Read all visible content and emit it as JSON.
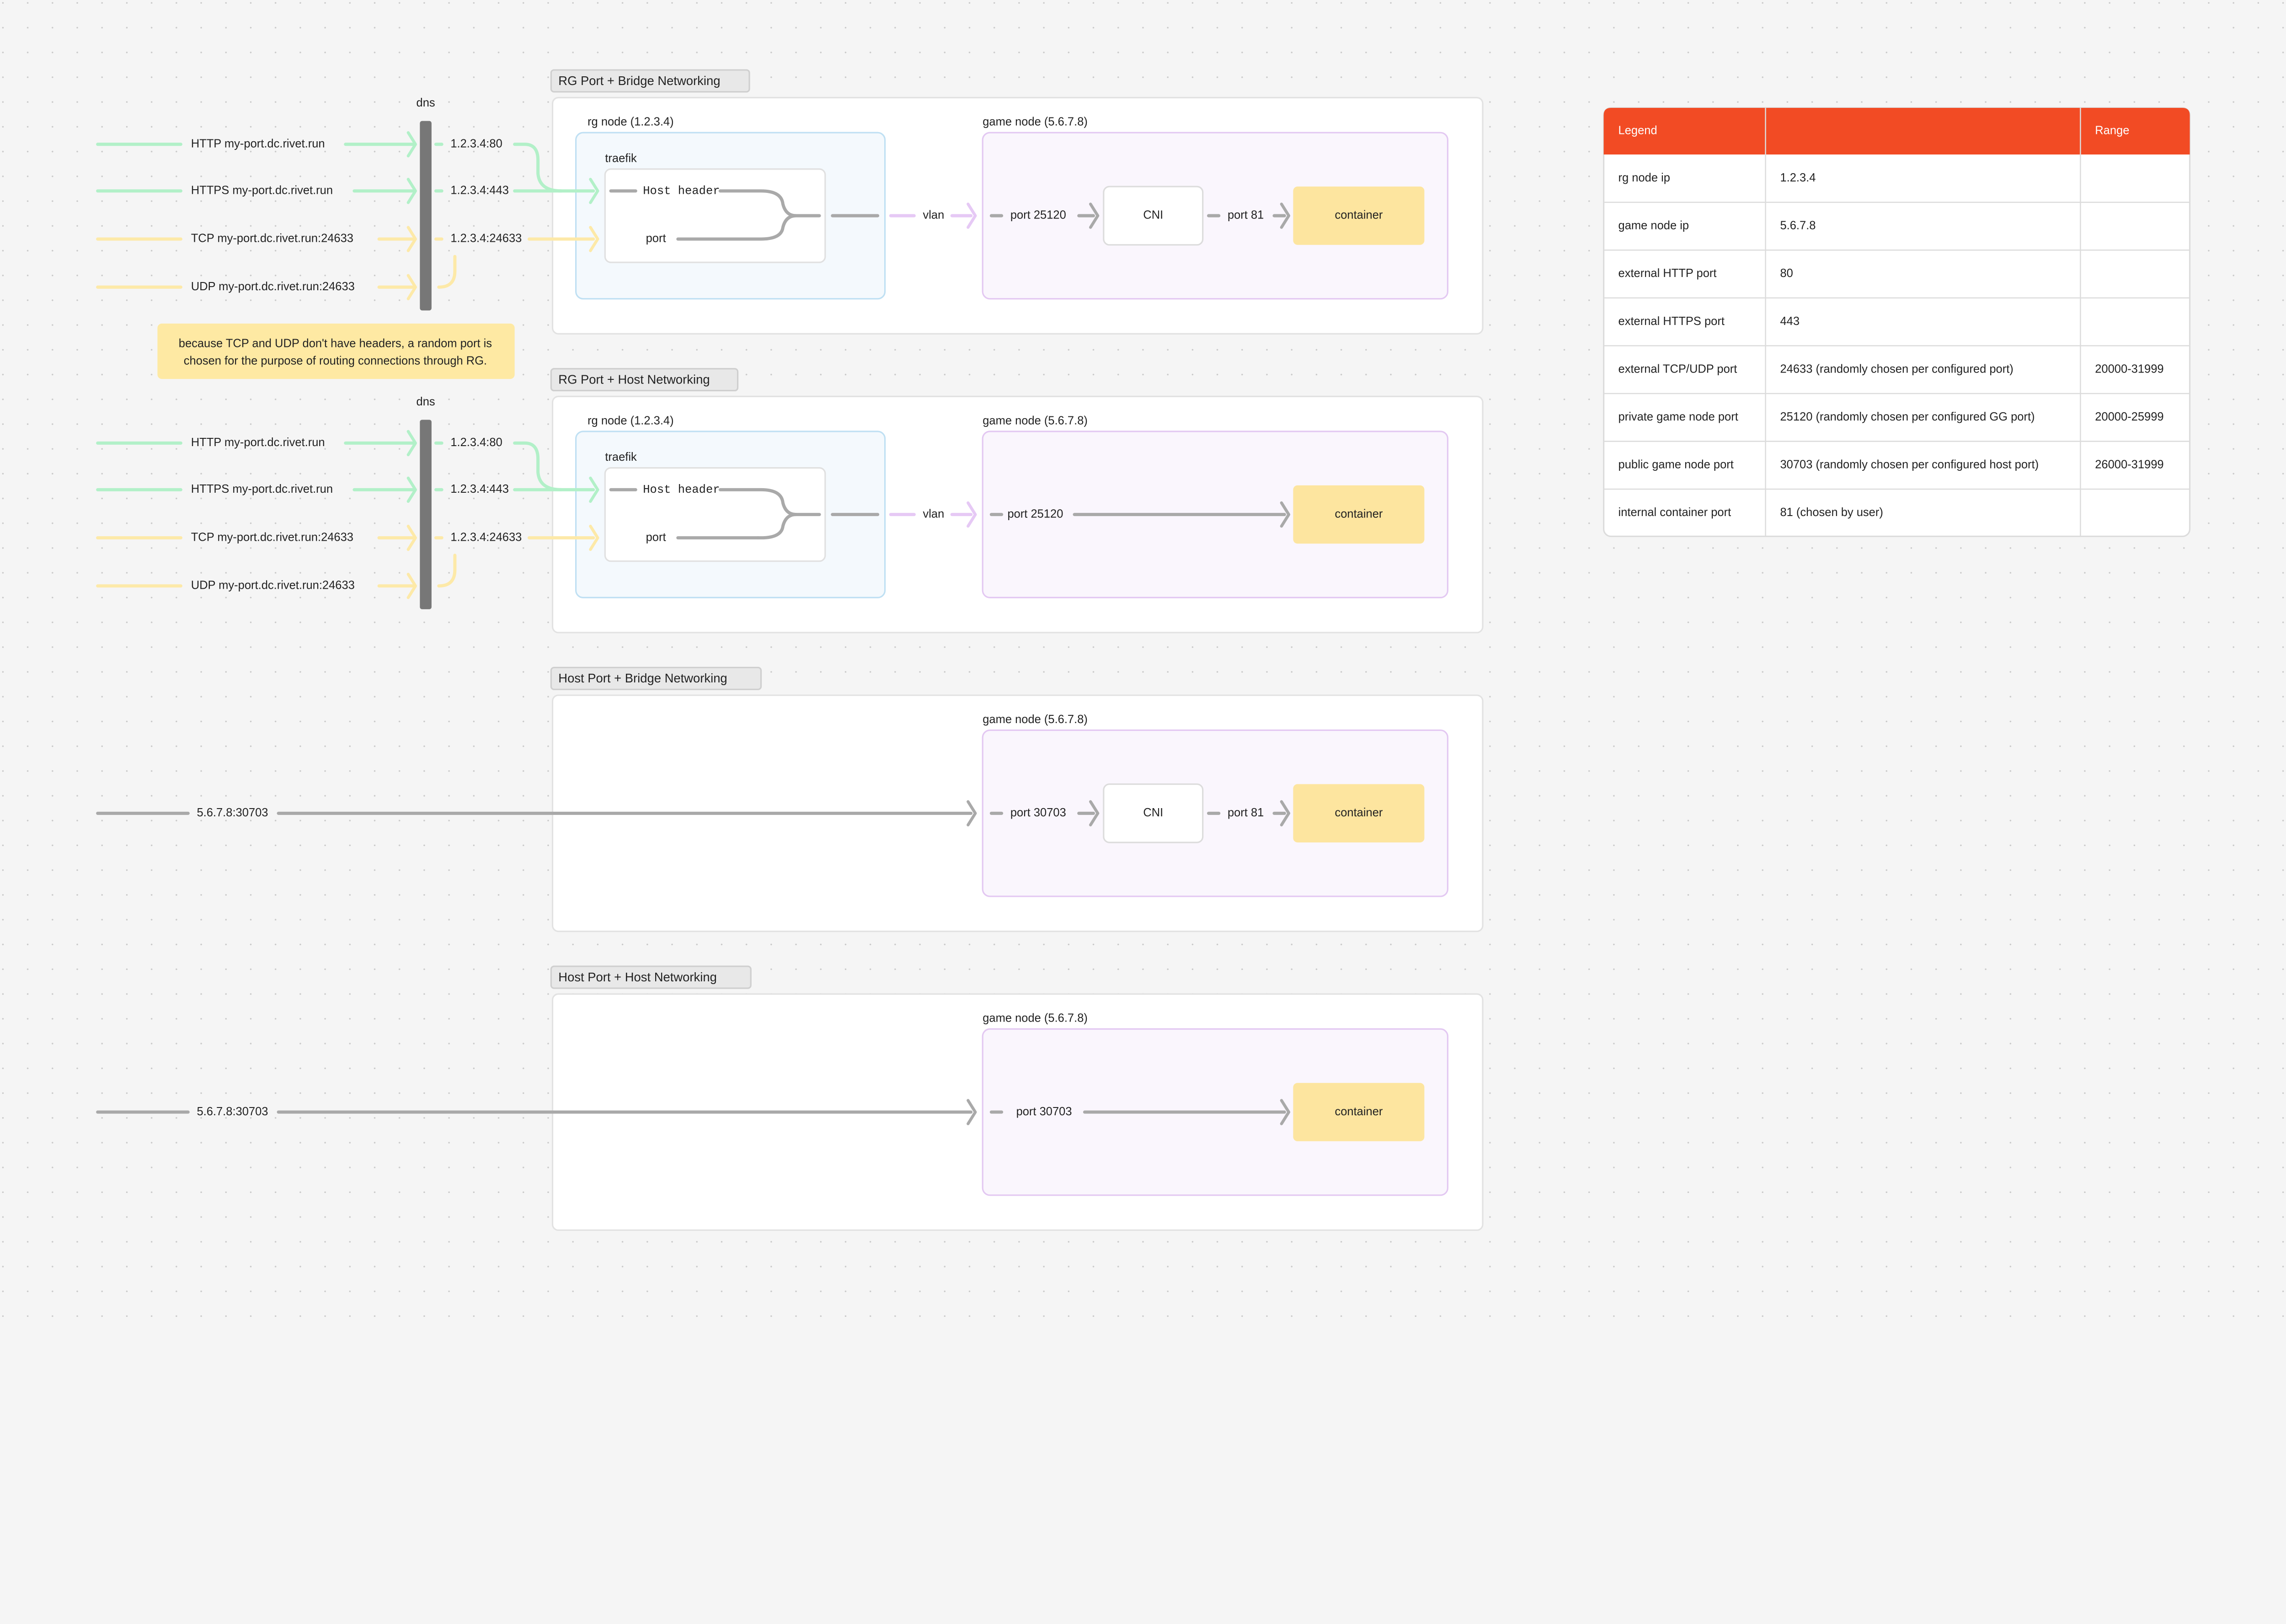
{
  "colors": {
    "http": "#b2f0c8",
    "tcp": "#fde9a8",
    "gray": "#a9a9a9",
    "vlan": "#e6c9f5",
    "rg_node_fill": "#f4f9fd",
    "rg_node_stroke": "#bfe0f3",
    "game_node_fill": "#faf6fd",
    "game_node_stroke": "#e3c8f2",
    "container": "#fde59f",
    "legend_header": "#f24b24",
    "dns_bar": "#777777"
  },
  "dns": {
    "label": "dns",
    "requests": [
      {
        "label": "HTTP my-port.dc.rivet.run",
        "target": "1.2.3.4:80",
        "kind": "http"
      },
      {
        "label": "HTTPS my-port.dc.rivet.run",
        "target": "1.2.3.4:443",
        "kind": "http"
      },
      {
        "label": "TCP my-port.dc.rivet.run:24633",
        "target": "1.2.3.4:24633",
        "kind": "tcp"
      },
      {
        "label": "UDP my-port.dc.rivet.run:24633",
        "target": "",
        "kind": "tcp"
      }
    ]
  },
  "note": {
    "line1": "because TCP and UDP don't have headers, a random port is",
    "line2": "chosen for the purpose of routing connections through RG."
  },
  "frames": [
    {
      "title": "RG Port + Bridge Networking",
      "rg_node": "rg node (1.2.3.4)",
      "traefik": "traefik",
      "host_header": "Host header",
      "port": "port",
      "vlan": "vlan",
      "game_node": "game node (5.6.7.8)",
      "entry_port": "port 25120",
      "cni": "CNI",
      "cni_port": "port 81",
      "container": "container"
    },
    {
      "title": "RG Port + Host Networking",
      "rg_node": "rg node (1.2.3.4)",
      "traefik": "traefik",
      "host_header": "Host header",
      "port": "port",
      "vlan": "vlan",
      "game_node": "game node (5.6.7.8)",
      "entry_port": "port 25120",
      "container": "container"
    },
    {
      "title": "Host Port + Bridge Networking",
      "source": "5.6.7.8:30703",
      "game_node": "game node (5.6.7.8)",
      "entry_port": "port 30703",
      "cni": "CNI",
      "cni_port": "port 81",
      "container": "container"
    },
    {
      "title": "Host Port + Host Networking",
      "source": "5.6.7.8:30703",
      "game_node": "game node (5.6.7.8)",
      "entry_port": "port 30703",
      "container": "container"
    }
  ],
  "legend": {
    "headers": [
      "Legend",
      "",
      "Range"
    ],
    "rows": [
      [
        "rg node ip",
        "1.2.3.4",
        ""
      ],
      [
        "game node ip",
        "5.6.7.8",
        ""
      ],
      [
        "external HTTP port",
        "80",
        ""
      ],
      [
        "external HTTPS port",
        "443",
        ""
      ],
      [
        "external TCP/UDP port",
        "24633 (randomly chosen per configured port)",
        "20000-31999"
      ],
      [
        "private game node port",
        "25120 (randomly chosen per configured GG port)",
        "20000-25999"
      ],
      [
        "public game node port",
        "30703 (randomly chosen per configured host port)",
        "26000-31999"
      ],
      [
        "internal container port",
        "81 (chosen by user)",
        ""
      ]
    ]
  }
}
